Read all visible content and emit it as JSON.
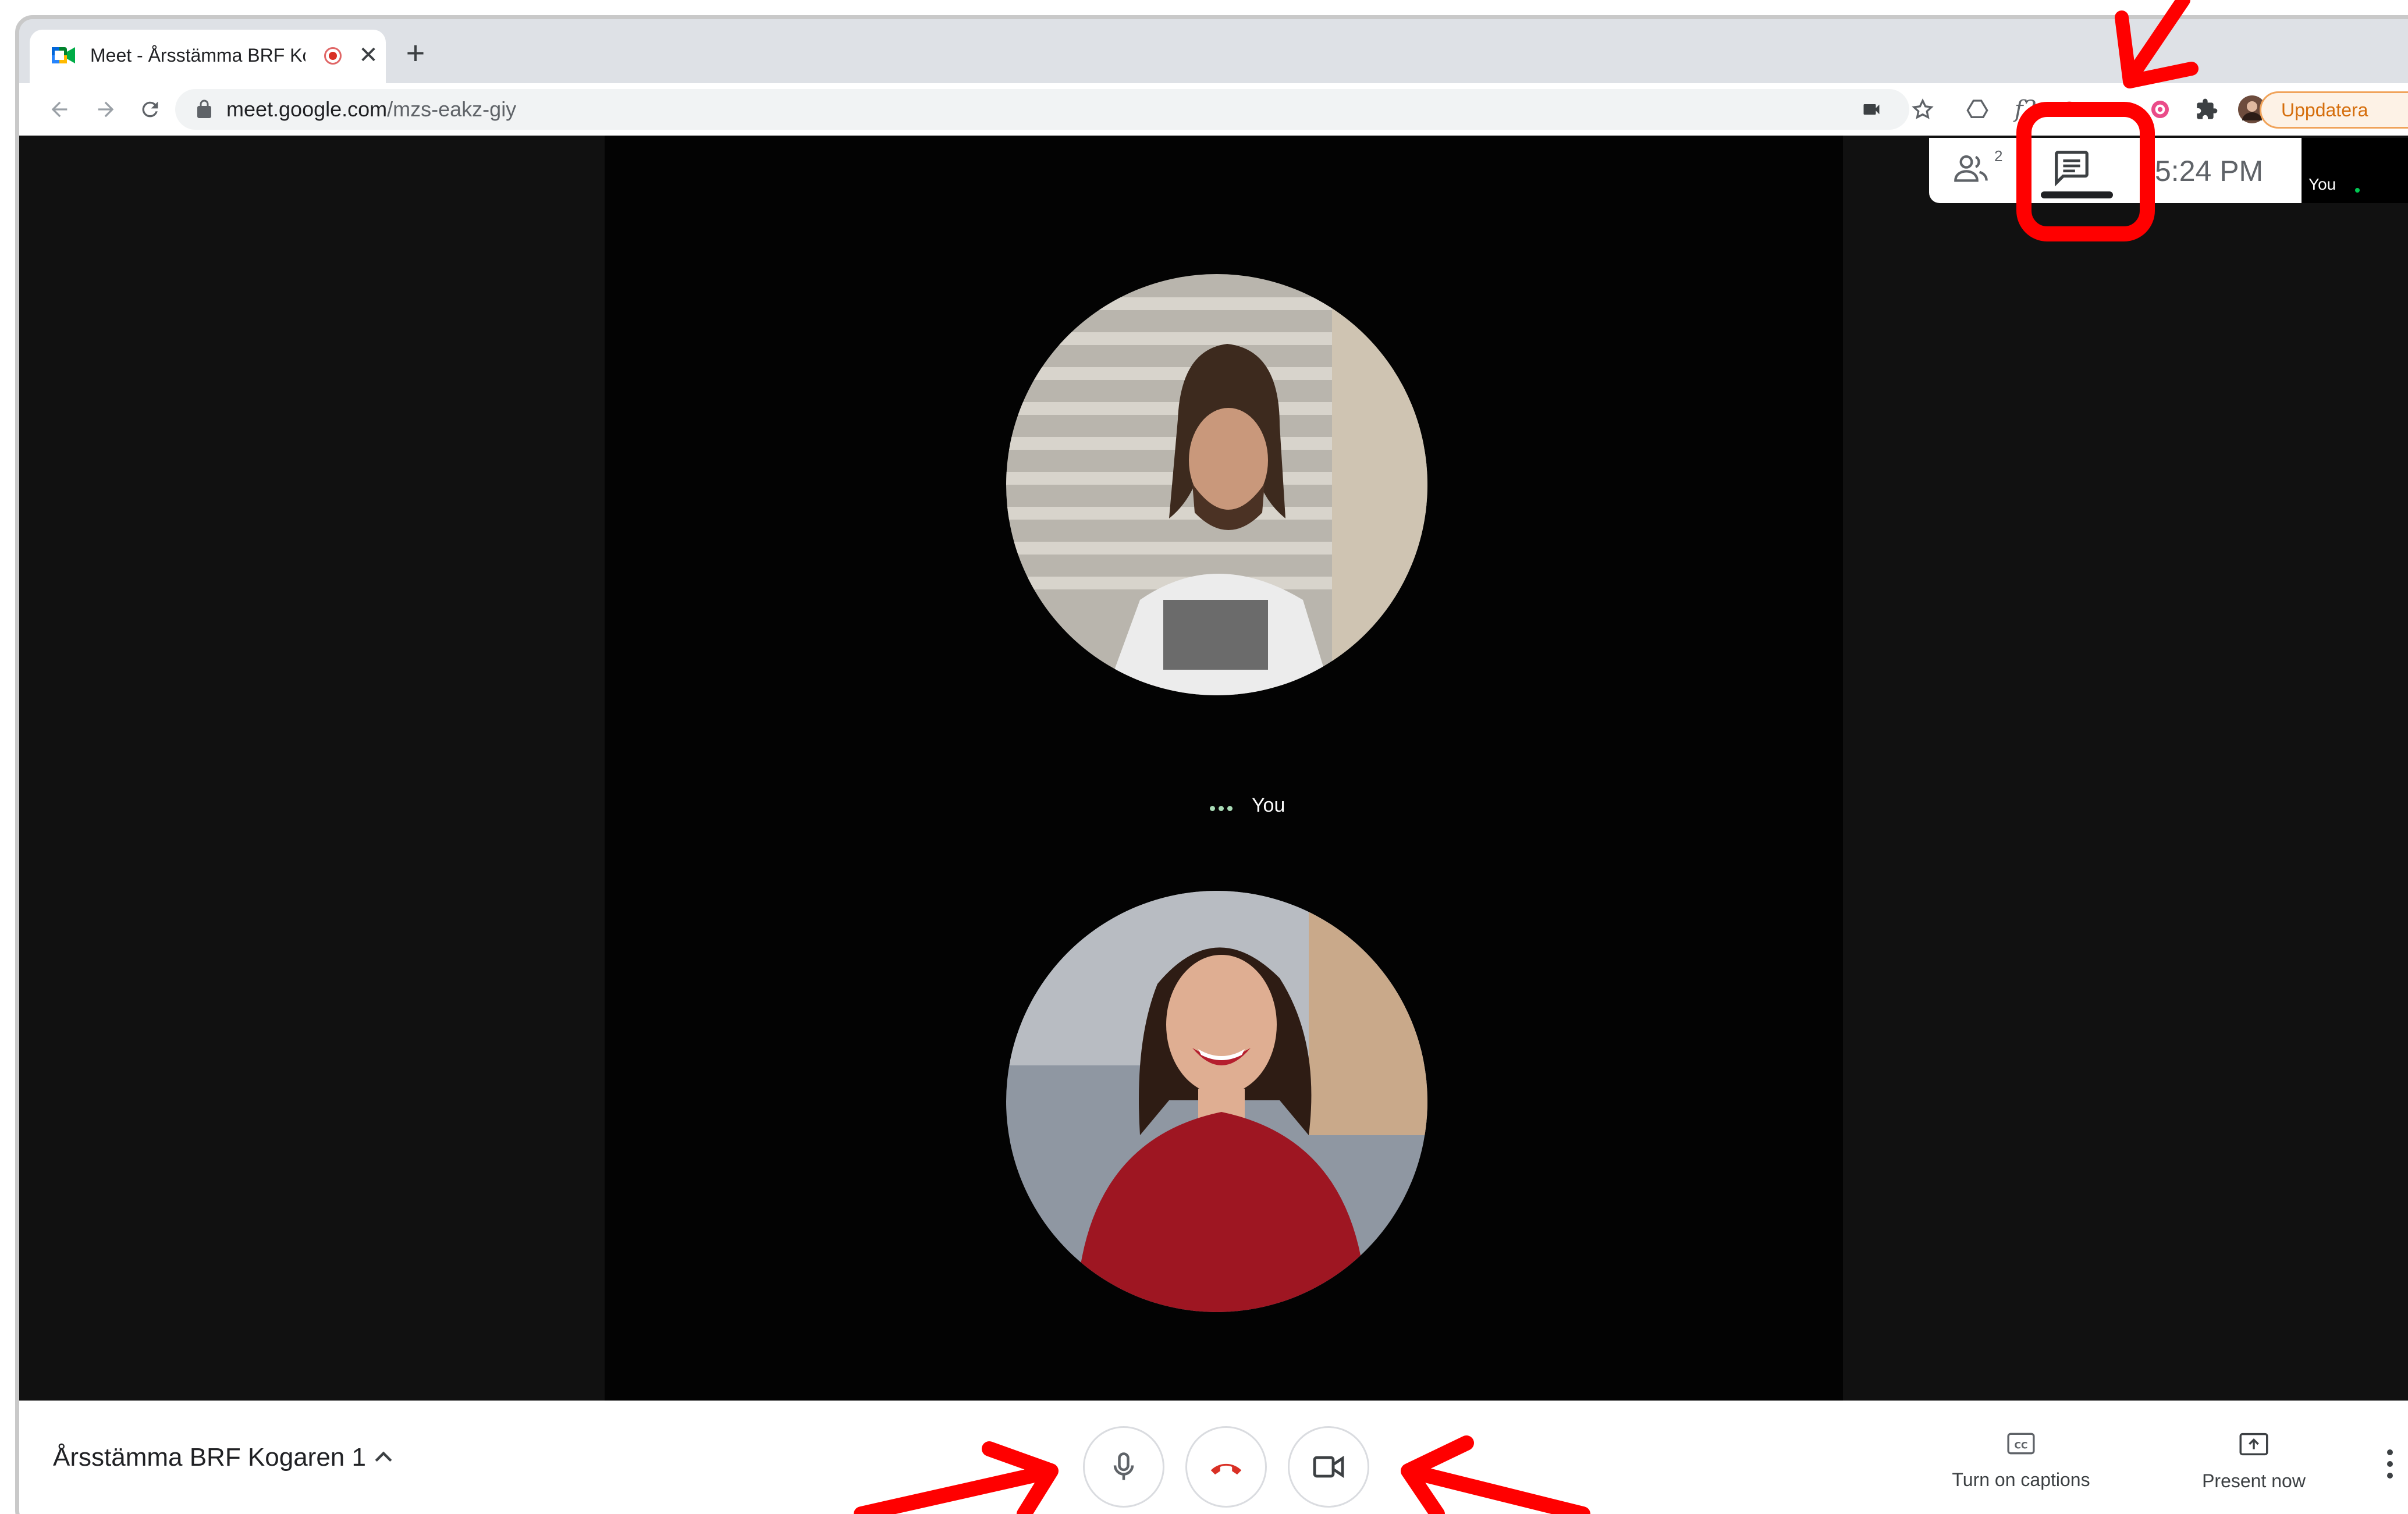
{
  "browser": {
    "tab": {
      "title": "Meet - Årsstämma BRF Ko",
      "close_glyph": "✕",
      "favicon": "google-meet-icon",
      "recording_indicator": "recording-dot-icon"
    },
    "new_tab_glyph": "+",
    "url_host": "meet.google.com",
    "url_path": "/mzs-eakz-giy",
    "update_button_label": "Uppdatera",
    "toolbar_icons": [
      "back-icon",
      "forward-icon",
      "reload-icon",
      "lock-icon",
      "camera-indicator-icon",
      "star-icon",
      "drive-icon",
      "formula-icon",
      "extension-icon",
      "puzzle-icon",
      "profile-avatar"
    ]
  },
  "meet": {
    "time": "5:24 PM",
    "participants_count": "2",
    "speaker_label": "You",
    "self_tile_label": "You",
    "meeting_title": "Årsstämma BRF Kogaren 1",
    "controls": {
      "captions_label": "Turn on captions",
      "present_label": "Present now"
    }
  },
  "colors": {
    "stage_bg": "#030303",
    "sidebar_bg": "#111111",
    "hangup_red": "#d93025",
    "annotation_red": "#ff0000",
    "update_orange": "#d56e0c"
  }
}
